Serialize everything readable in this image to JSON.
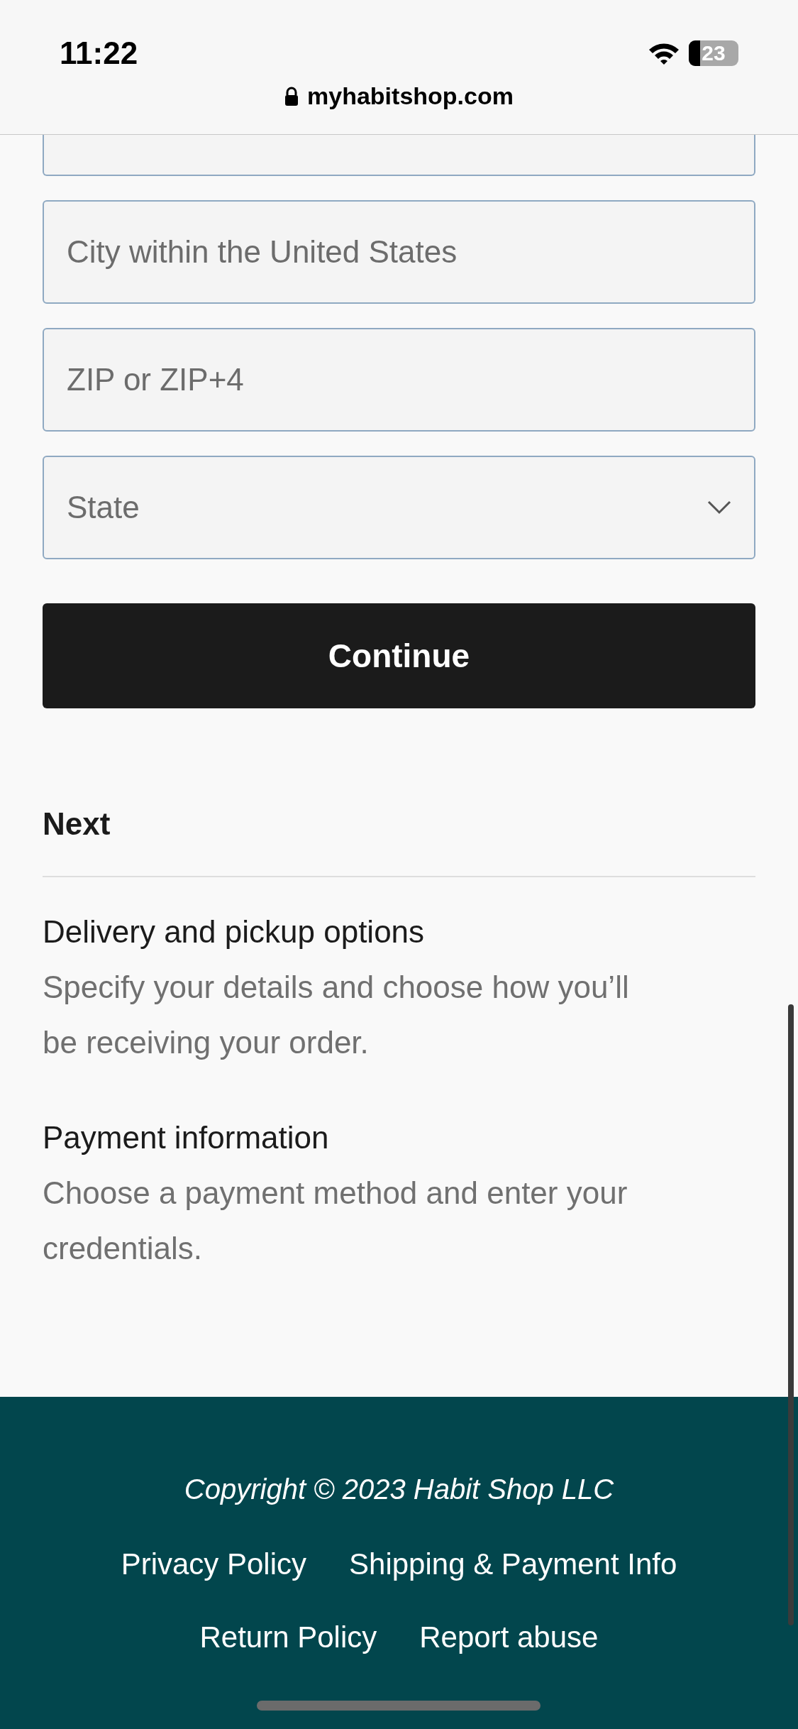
{
  "status_bar": {
    "time": "11:22",
    "battery": "23"
  },
  "address_bar": {
    "url": "myhabitshop.com"
  },
  "fields": [
    {
      "kind": "text",
      "placeholder": "City within the United States"
    },
    {
      "kind": "text",
      "placeholder": "ZIP or ZIP+4"
    },
    {
      "kind": "select",
      "placeholder": "State"
    }
  ],
  "continue_button": "Continue",
  "next": {
    "title": "Next",
    "steps": [
      {
        "title": "Delivery and pickup options",
        "description": "Specify your details and choose how you’ll be receiving your order."
      },
      {
        "title": "Payment information",
        "description": "Choose a payment method and enter your credentials."
      }
    ]
  },
  "footer": {
    "copyright": "Copyright © 2023 Habit Shop LLC",
    "link_rows": [
      [
        "Privacy Policy",
        "Shipping & Payment Info"
      ],
      [
        "Return Policy",
        "Report abuse"
      ]
    ]
  }
}
